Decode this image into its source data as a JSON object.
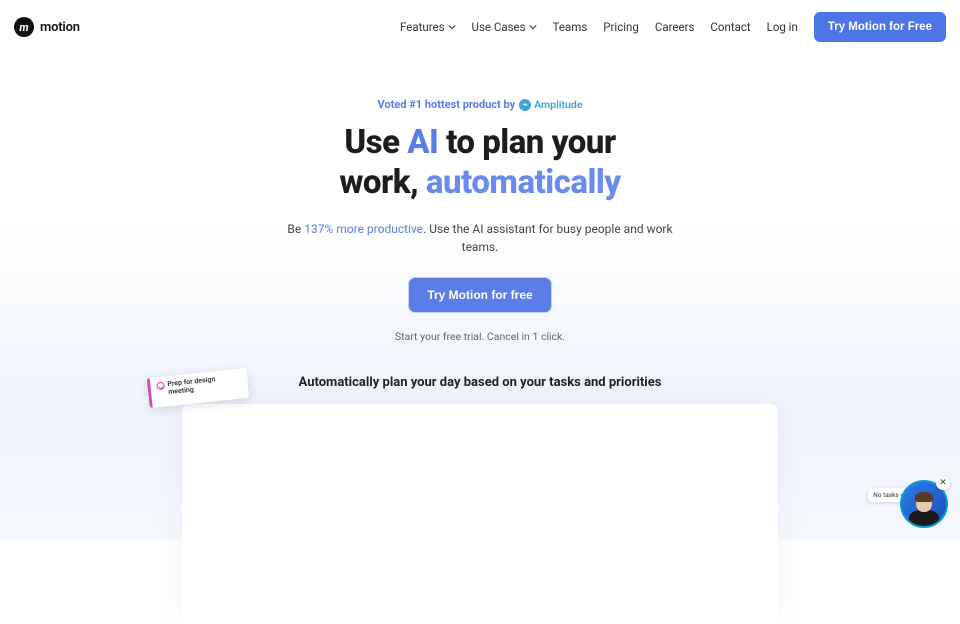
{
  "brand": "motion",
  "nav": {
    "items": [
      {
        "label": "Features",
        "dropdown": true
      },
      {
        "label": "Use Cases",
        "dropdown": true
      },
      {
        "label": "Teams",
        "dropdown": false
      },
      {
        "label": "Pricing",
        "dropdown": false
      },
      {
        "label": "Careers",
        "dropdown": false
      },
      {
        "label": "Contact",
        "dropdown": false
      },
      {
        "label": "Log in",
        "dropdown": false
      }
    ],
    "cta": "Try Motion for Free"
  },
  "hero": {
    "voted_prefix": "Voted #1 hottest product by",
    "voted_brand": "Amplitude",
    "headline_1": "Use ",
    "headline_ai": "AI",
    "headline_2": " to plan your",
    "headline_3": "work, ",
    "headline_auto": "automatically",
    "sub_1": "Be ",
    "sub_accent": "137% more productive",
    "sub_2": ". Use the AI assistant for busy people and work",
    "sub_3": "teams.",
    "cta": "Try Motion for free",
    "trial_note": "Start your free trial. Cancel in 1 click.",
    "section_title": "Automatically plan your day based on your tasks and priorities"
  },
  "task_chip": {
    "label": "Prep for design meeting"
  },
  "chat": {
    "bubble": "No tasks yet",
    "close": "✕"
  }
}
